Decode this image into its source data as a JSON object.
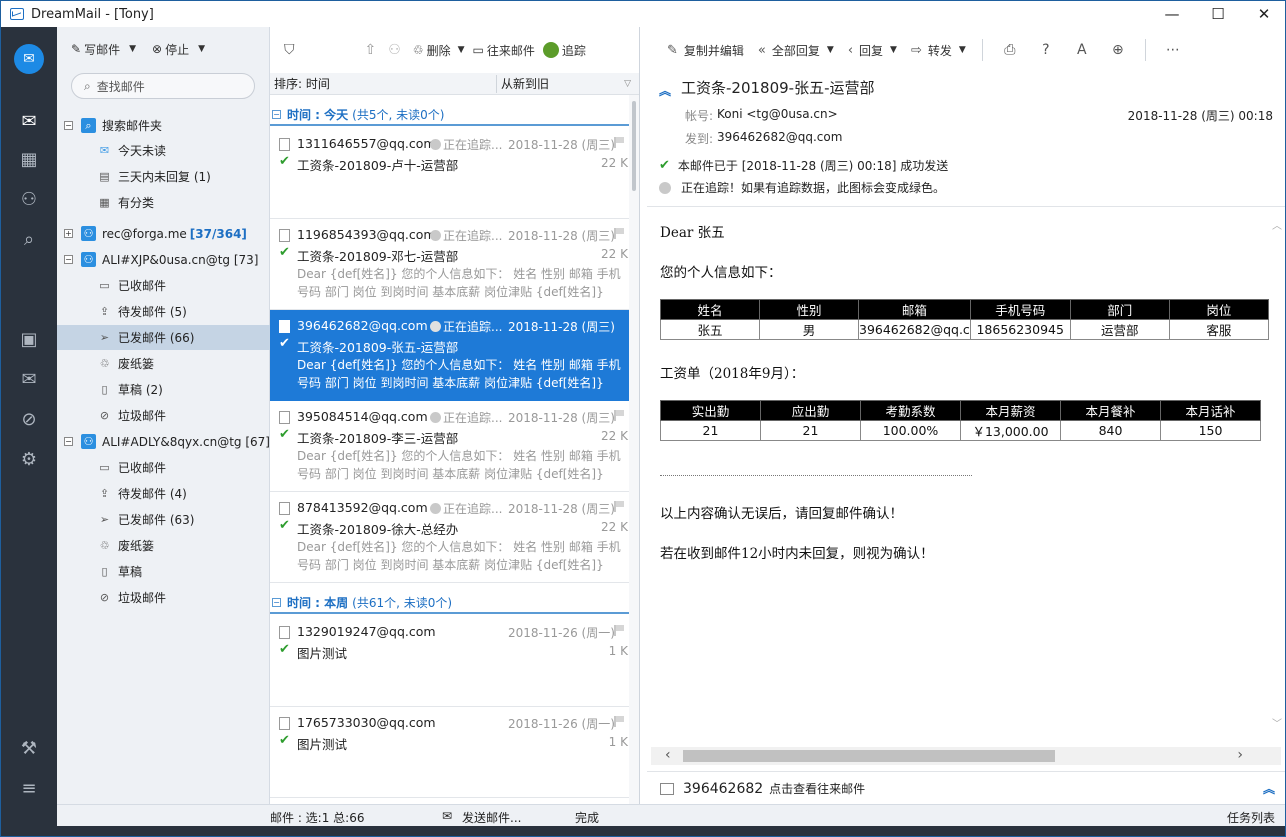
{
  "window": {
    "title": "DreamMail - [Tony]",
    "minimize": "—",
    "maximize": "☐",
    "close": "✕"
  },
  "rail": {
    "icons": [
      "mail-logo-icon",
      "envelope-icon",
      "calendar-icon",
      "contacts-icon",
      "search-icon",
      "address-book-icon",
      "send-icon",
      "attachment-icon",
      "settings-icon",
      "tools-icon",
      "menu-icon"
    ]
  },
  "folder_toolbar": {
    "compose": "写邮件",
    "stop": "停止",
    "search_placeholder": "查找邮件"
  },
  "tree": {
    "search_folder": "搜索邮件夹",
    "today_unread": "今天未读",
    "three_days_unreplied": "三天内未回复 (1)",
    "categorized": "有分类",
    "account1": "rec@forga.me",
    "account1_count": "[37/364]",
    "account2": "ALI#XJP&0usa.cn@tg [73]",
    "a2_inbox": "已收邮件",
    "a2_outbox": "待发邮件 (5)",
    "a2_sent": "已发邮件 (66)",
    "a2_trash": "废纸篓",
    "a2_drafts": "草稿 (2)",
    "a2_spam": "垃圾邮件",
    "account3": "ALI#ADLY&8qyx.cn@tg [67]",
    "a3_inbox": "已收邮件",
    "a3_outbox": "待发邮件 (4)",
    "a3_sent": "已发邮件 (63)",
    "a3_trash": "废纸篓",
    "a3_drafts": "草稿",
    "a3_spam": "垃圾邮件"
  },
  "list_toolbar": {
    "delete": "删除",
    "history": "往来邮件",
    "track": "追踪"
  },
  "sort": {
    "by": "排序: 时间",
    "order": "从新到旧"
  },
  "groups": {
    "today": "时间 : 今天",
    "today_count": "(共5个, 未读0个)",
    "week": "时间 : 本周",
    "week_count": "(共61个, 未读0个)"
  },
  "messages": [
    {
      "from": "1311646557@qq.com",
      "track": "正在追踪...",
      "date": "2018-11-28 (周三)",
      "subject": "工资条-201809-卢十-运营部",
      "size": "22 K",
      "preview": ""
    },
    {
      "from": "1196854393@qq.com",
      "track": "正在追踪...",
      "date": "2018-11-28 (周三)",
      "subject": "工资条-201809-邓七-运营部",
      "size": "22 K",
      "preview": "Dear {def[姓名]} 您的个人信息如下： 姓名 性别 邮箱 手机号码 部门 岗位 到岗时间 基本底薪 岗位津贴 {def[姓名]} {def..."
    },
    {
      "from": "396462682@qq.com",
      "track": "正在追踪...",
      "date": "2018-11-28 (周三)",
      "subject": "工资条-201809-张五-运营部",
      "size": "",
      "preview": "Dear {def[姓名]} 您的个人信息如下： 姓名 性别 邮箱 手机号码 部门 岗位 到岗时间 基本底薪 岗位津贴 {def[姓名]} {def..."
    },
    {
      "from": "395084514@qq.com",
      "track": "正在追踪...",
      "date": "2018-11-28 (周三)",
      "subject": "工资条-201809-李三-运营部",
      "size": "22 K",
      "preview": "Dear {def[姓名]} 您的个人信息如下： 姓名 性别 邮箱 手机号码 部门 岗位 到岗时间 基本底薪 岗位津贴 {def[姓名]} {def..."
    },
    {
      "from": "878413592@qq.com",
      "track": "正在追踪...",
      "date": "2018-11-28 (周三)",
      "subject": "工资条-201809-徐大-总经办",
      "size": "22 K",
      "preview": "Dear {def[姓名]} 您的个人信息如下： 姓名 性别 邮箱 手机号码 部门 岗位 到岗时间 基本底薪 岗位津贴 {def[姓名]} {def..."
    },
    {
      "from": "1329019247@qq.com",
      "track": "",
      "date": "2018-11-26 (周一)",
      "subject": "图片测试",
      "size": "1 K",
      "preview": ""
    },
    {
      "from": "1765733030@qq.com",
      "track": "",
      "date": "2018-11-26 (周一)",
      "subject": "图片测试",
      "size": "1 K",
      "preview": ""
    }
  ],
  "read_toolbar": {
    "copy_edit": "复制并编辑",
    "reply_all": "全部回复",
    "reply": "回复",
    "forward": "转发"
  },
  "reader": {
    "subject": "工资条-201809-张五-运营部",
    "account_label": "帐号:",
    "account_value": "Koni <tg@0usa.cn>",
    "to_label": "发到:",
    "to_value": "396462682@qq.com",
    "date": "2018-11-28 (周三) 00:18",
    "sent_status": "本邮件已于 [2018-11-28 (周三) 00:18] 成功发送",
    "tracking_status": "正在追踪！如果有追踪数据，此图标会变成绿色。"
  },
  "email_body": {
    "greeting": "Dear 张五",
    "info_intro": "您的个人信息如下：",
    "info_headers": [
      "姓名",
      "性别",
      "邮箱",
      "手机号码",
      "部门",
      "岗位"
    ],
    "info_row": [
      "张五",
      "男",
      "396462682@qq.c",
      "18656230945",
      "运营部",
      "客服"
    ],
    "salary_intro": "工资单（2018年9月）：",
    "salary_headers": [
      "实出勤",
      "应出勤",
      "考勤系数",
      "本月薪资",
      "本月餐补",
      "本月话补"
    ],
    "salary_row": [
      "21",
      "21",
      "100.00%",
      "￥13,000.00",
      "840",
      "150"
    ],
    "confirm": "以上内容确认无误后，请回复邮件确认！",
    "timeout": "若在收到邮件12小时内未回复，则视为确认！"
  },
  "contact_bar": {
    "name": "396462682",
    "hint": "点击查看往来邮件"
  },
  "statusbar": {
    "selection": "邮件 : 选:1 总:66",
    "sending": "发送邮件...",
    "done": "完成",
    "tasks": "任务列表"
  }
}
